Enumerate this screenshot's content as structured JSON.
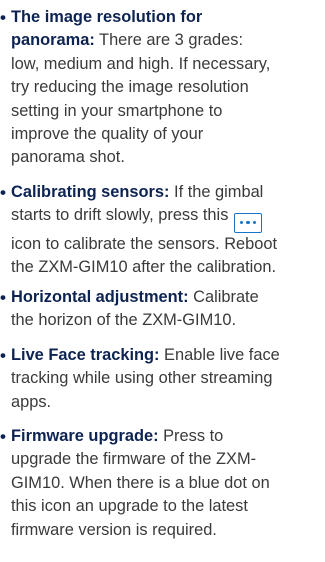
{
  "bullet_glyph": "•",
  "items": [
    {
      "term": "The image resolution for",
      "term_cont": "panorama:",
      "lines": [
        " There are 3 grades:",
        "low, medium and high. If necessary,",
        "try reducing the image resolution",
        "setting in your smartphone to",
        "improve the quality of your",
        "panorama shot."
      ]
    },
    {
      "term": "Calibrating sensors:",
      "lines": [
        " If the gimbal",
        "starts to drift slowly, press this",
        "icon to calibrate the sensors. Reboot",
        "the ZXM-GIM10 after the calibration."
      ],
      "icon": "more-dots-icon"
    },
    {
      "term": "Horizontal adjustment:",
      "lines": [
        " Calibrate",
        "the horizon of the ZXM-GIM10."
      ]
    },
    {
      "term": "Live Face tracking:",
      "lines": [
        " Enable live face",
        "tracking while using other streaming",
        "apps."
      ]
    },
    {
      "term": "Firmware upgrade:",
      "lines": [
        " Press to",
        "upgrade the firmware of the ZXM-",
        "GIM10. When there is a blue dot on",
        "this icon an upgrade to the latest",
        "firmware version is required."
      ]
    }
  ]
}
